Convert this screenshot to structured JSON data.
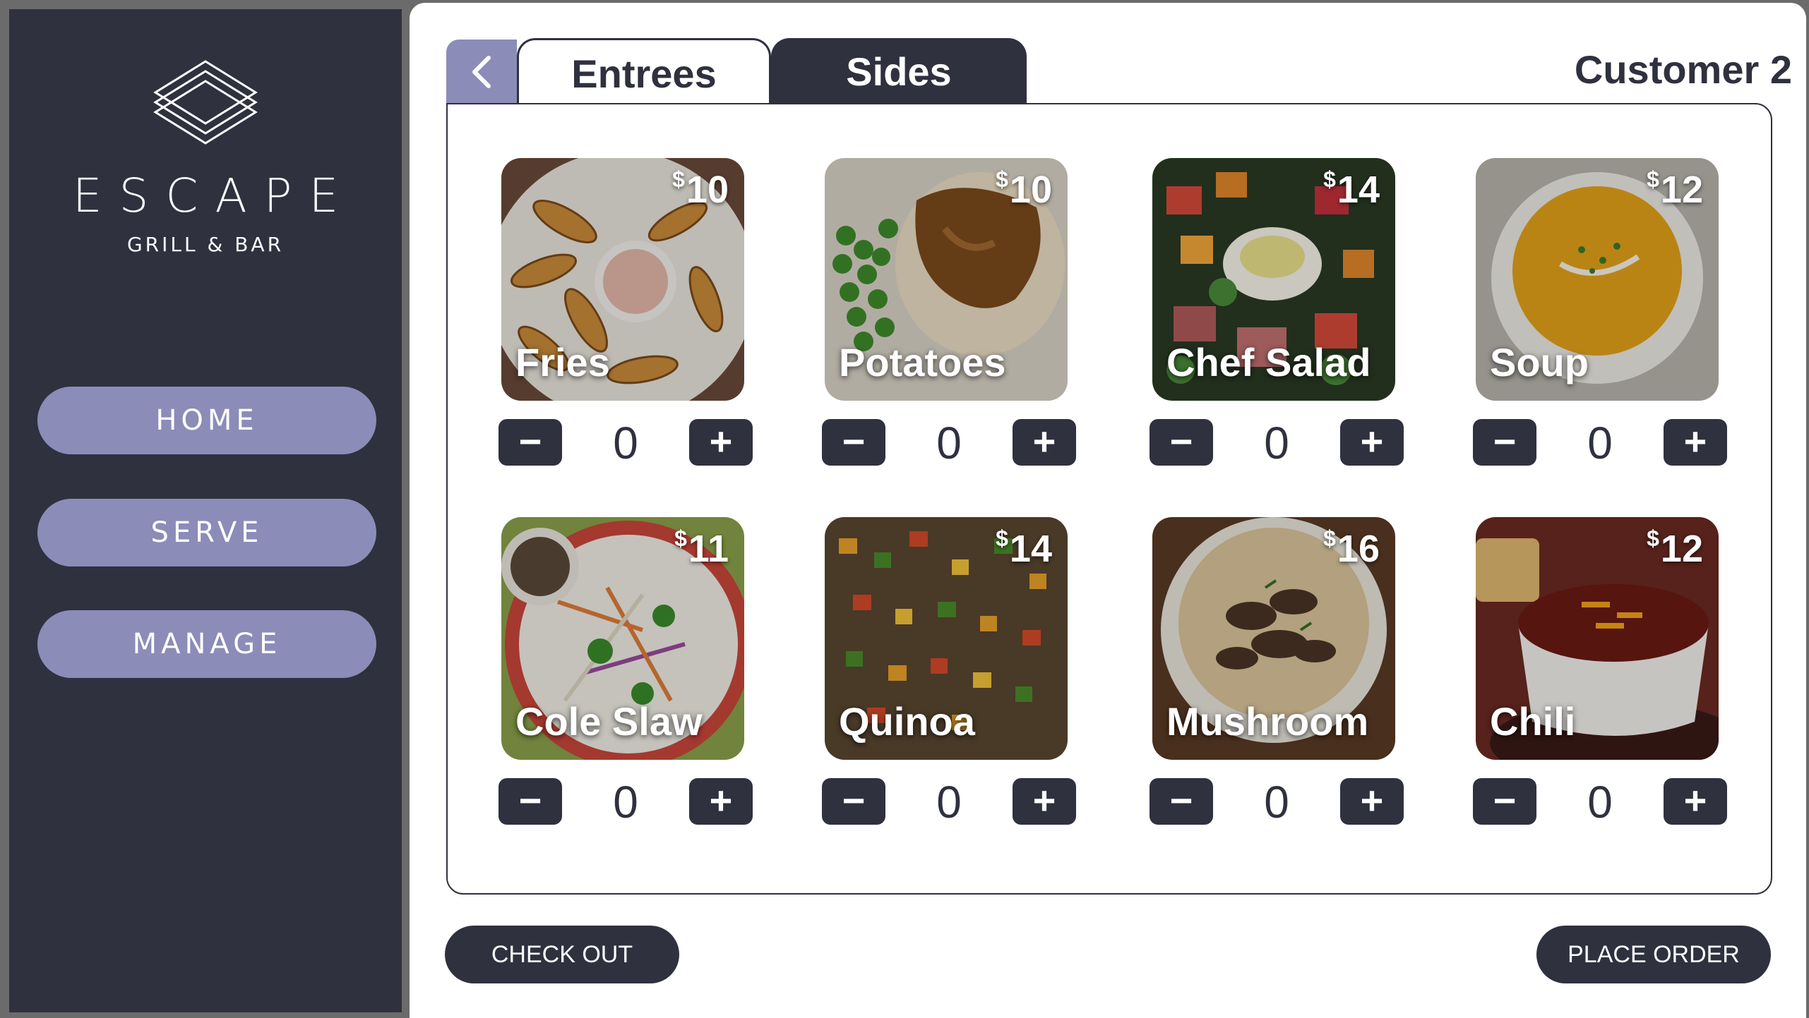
{
  "brand": {
    "name": "ESCAPE",
    "tagline": "GRILL & BAR"
  },
  "nav": {
    "home": "HOME",
    "serve": "SERVE",
    "manage": "MANAGE"
  },
  "tabs": {
    "entrees": "Entrees",
    "sides": "Sides",
    "active": "Sides"
  },
  "customer": "Customer 2",
  "items": [
    {
      "name": "Fries",
      "currency": "$",
      "price": "10",
      "qty": "0"
    },
    {
      "name": "Potatoes",
      "currency": "$",
      "price": "10",
      "qty": "0"
    },
    {
      "name": "Chef Salad",
      "currency": "$",
      "price": "14",
      "qty": "0"
    },
    {
      "name": "Soup",
      "currency": "$",
      "price": "12",
      "qty": "0"
    },
    {
      "name": "Cole Slaw",
      "currency": "$",
      "price": "11",
      "qty": "0"
    },
    {
      "name": "Quinoa",
      "currency": "$",
      "price": "14",
      "qty": "0"
    },
    {
      "name": "Mushroom",
      "currency": "$",
      "price": "16",
      "qty": "0"
    },
    {
      "name": "Chili",
      "currency": "$",
      "price": "12",
      "qty": "0"
    }
  ],
  "stepper": {
    "minus": "−",
    "plus": "+"
  },
  "actions": {
    "checkout": "CHECK OUT",
    "place_order": "PLACE ORDER"
  },
  "colors": {
    "dark": "#2f313f",
    "accent": "#8b8cb8",
    "background": "#ffffff"
  },
  "icons": {
    "back": "chevron-left-icon",
    "logo": "stacked-diamonds-logo"
  }
}
